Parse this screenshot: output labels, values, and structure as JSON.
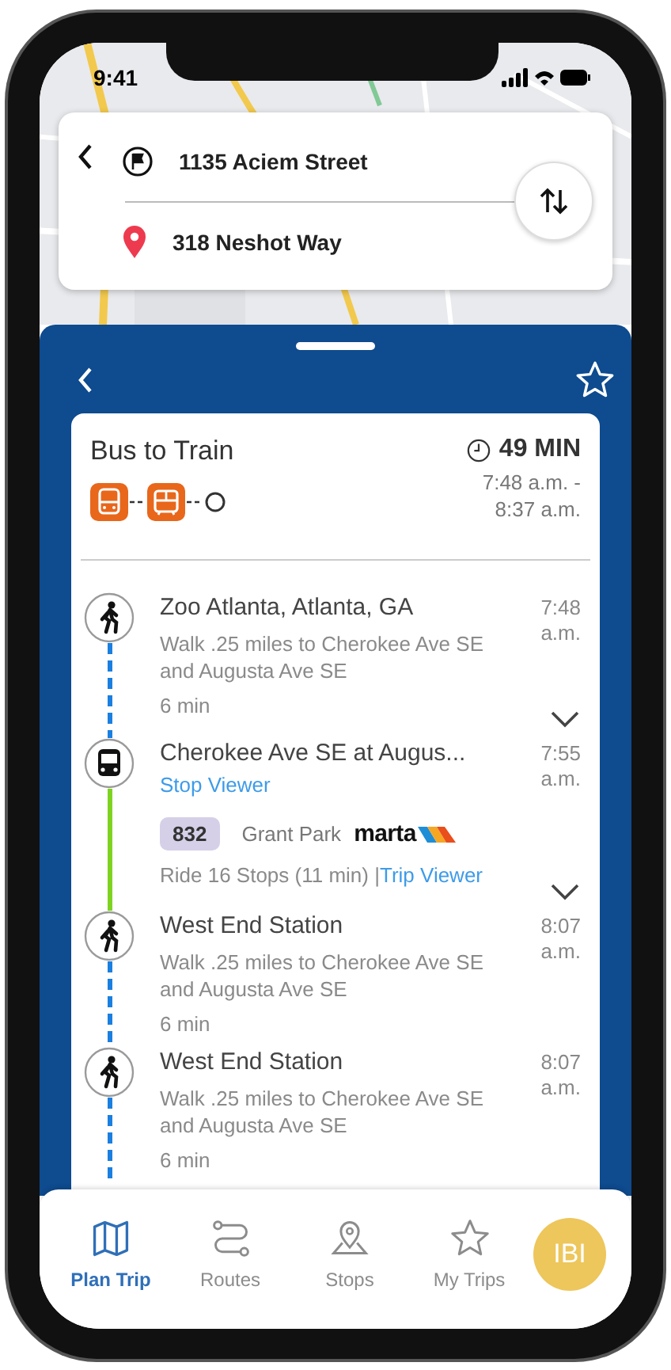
{
  "status_bar": {
    "time": "9:41"
  },
  "route_search": {
    "origin": "1135 Aciem Street",
    "destination": "318 Neshot Way"
  },
  "trip": {
    "title": "Bus to Train",
    "duration": "49 MIN",
    "departure": "7:48 a.m. -",
    "arrival": "8:37 a.m.",
    "favorite": false,
    "modes": [
      {
        "kind": "bus"
      },
      {
        "kind": "train"
      }
    ]
  },
  "legs": [
    {
      "kind": "walk",
      "color": "#1a7fe0",
      "place": "Zoo Atlanta, Atlanta, GA",
      "time": "7:48 a.m.",
      "directions": "Walk .25 miles to Cherokee Ave SE and Augusta Ave SE",
      "duration": "6 min",
      "details_toggle": {
        "expanded": false
      }
    },
    {
      "kind": "bus",
      "color": "#7ed321",
      "place": "Cherokee Ave SE at Augus...",
      "time": "7:55 a.m.",
      "link": "Stop Viewer",
      "route": "832",
      "headsign": "Grant Park",
      "agency": "marta",
      "ride": "Ride 16 Stops (11 min) |",
      "ride_link": "Trip Viewer",
      "details_toggle": {
        "expanded": false
      }
    },
    {
      "kind": "walk",
      "color": "#1a7fe0",
      "place": "West End Station",
      "time": "8:07 a.m.",
      "directions": "Walk .25 miles to Cherokee Ave SE and Augusta Ave SE",
      "duration": "6 min"
    },
    {
      "kind": "walk",
      "color": "#1a7fe0",
      "place": "West End Station",
      "time": "8:07 a.m.",
      "directions": "Walk .25 miles to Cherokee Ave SE and Augusta Ave SE",
      "duration": "6 min"
    }
  ],
  "nav": [
    {
      "kind": "map",
      "label": "Plan Trip",
      "selected": true
    },
    {
      "kind": "routes",
      "label": "Routes",
      "selected": false
    },
    {
      "kind": "stops",
      "label": "Stops",
      "selected": false
    },
    {
      "kind": "trips",
      "label": "My Trips",
      "selected": false
    }
  ],
  "profile": {
    "initials": "IBI"
  }
}
